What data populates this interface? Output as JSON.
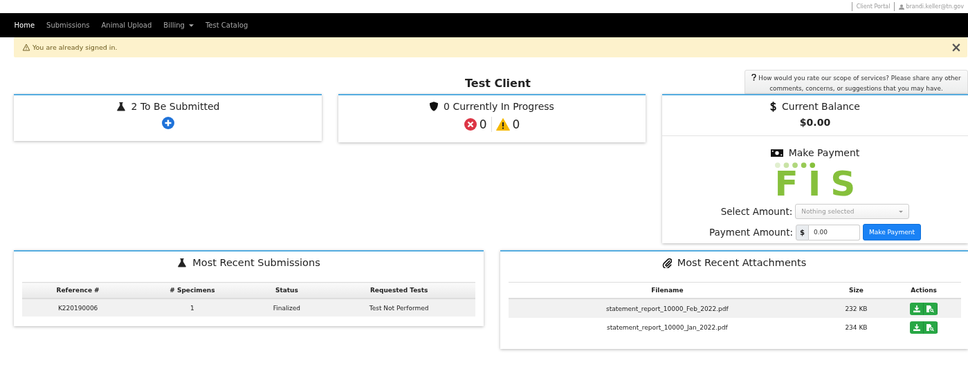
{
  "top_bar": {
    "link": "Client Portal",
    "user": "brandi.keller@tn.gov"
  },
  "nav": [
    {
      "label": "Home",
      "selected": true,
      "dropdown": false
    },
    {
      "label": "Submissions",
      "selected": false,
      "dropdown": false
    },
    {
      "label": "Animal Upload",
      "selected": false,
      "dropdown": false
    },
    {
      "label": "Billing",
      "selected": false,
      "dropdown": true
    },
    {
      "label": "Test Catalog",
      "selected": false,
      "dropdown": false
    }
  ],
  "alert": {
    "text": "You are already signed in.",
    "close": "×"
  },
  "page_title": "Test Client",
  "feedback": "How would you rate our scope of services? Please share any other comments, concerns, or suggestions that you may have.",
  "to_be_submitted": {
    "title": "2 To Be Submitted"
  },
  "in_progress": {
    "title": "0 Currently In Progress",
    "error_count": "0",
    "warning_count": "0"
  },
  "balance": {
    "title": "Current Balance",
    "amount": "$0.00"
  },
  "payment": {
    "title": "Make Payment",
    "select_label": "Select Amount:",
    "select_placeholder": "Nothing selected",
    "amount_label": "Payment Amount:",
    "currency": "$",
    "amount_value": "0.00",
    "button": "Make Payment",
    "logo_text": "FIS"
  },
  "submissions": {
    "title": "Most Recent Submissions",
    "columns": [
      "Reference #",
      "# Specimens",
      "Status",
      "Requested Tests"
    ],
    "rows": [
      [
        "K220190006",
        "1",
        "Finalized",
        "Test Not Performed"
      ]
    ]
  },
  "attachments": {
    "title": "Most Recent Attachments",
    "columns": [
      "Filename",
      "Size",
      "Actions"
    ],
    "rows": [
      {
        "filename": "statement_report_10000_Feb_2022.pdf",
        "size": "232 KB"
      },
      {
        "filename": "statement_report_10000_Jan_2022.pdf",
        "size": "234 KB"
      }
    ]
  }
}
